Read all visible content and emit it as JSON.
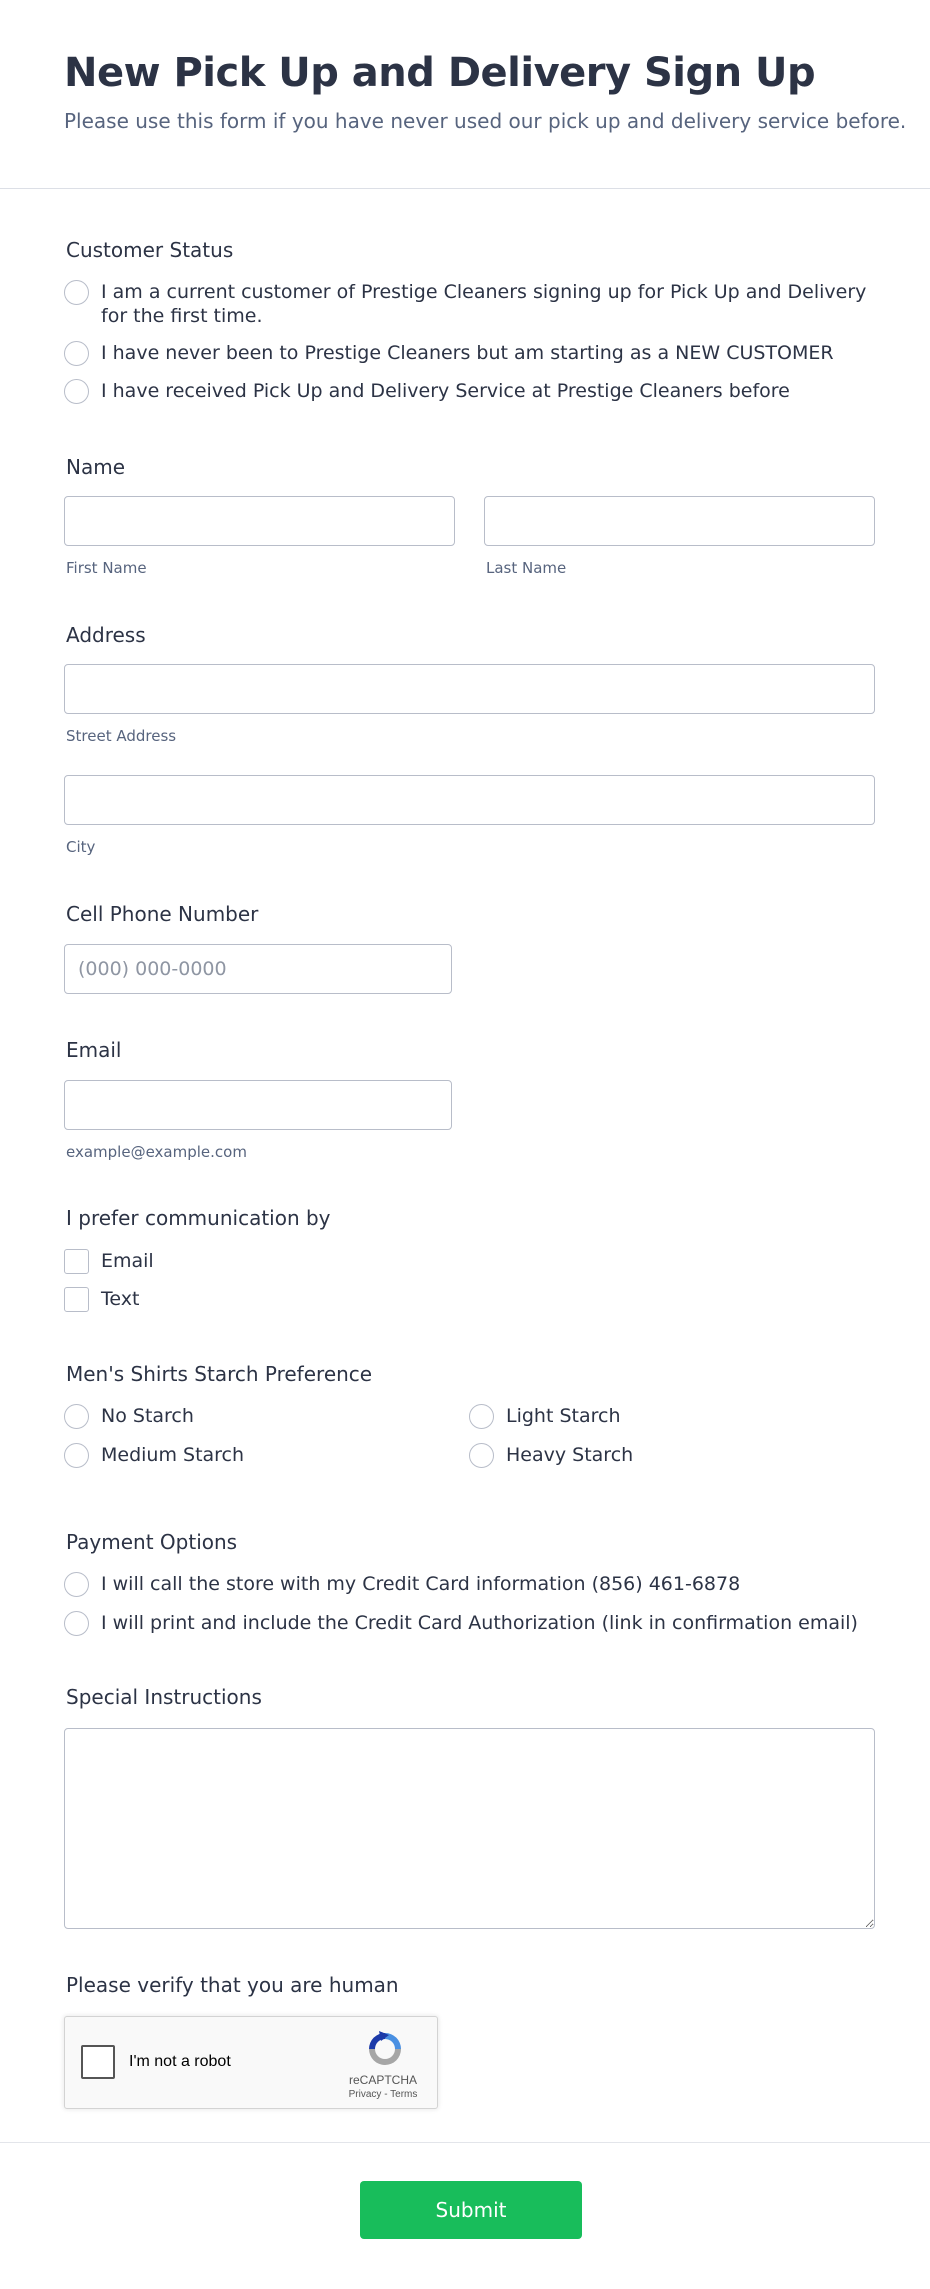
{
  "form": {
    "title": "New Pick Up and Delivery Sign Up",
    "subtitle": "Please use this form if you have never used our pick up and delivery service before."
  },
  "customer_status": {
    "label": "Customer Status",
    "options": [
      "I am a current customer of Prestige Cleaners signing up for Pick Up and Delivery for the first time.",
      "I have never been to Prestige Cleaners but am starting as a NEW CUSTOMER",
      "I have received Pick Up and Delivery Service at Prestige Cleaners before"
    ]
  },
  "name": {
    "label": "Name",
    "first_value": "",
    "last_value": "",
    "first_sublabel": "First Name",
    "last_sublabel": "Last Name"
  },
  "address": {
    "label": "Address",
    "street_value": "",
    "city_value": "",
    "street_sublabel": "Street Address",
    "city_sublabel": "City"
  },
  "phone": {
    "label": "Cell Phone Number",
    "placeholder": "(000) 000-0000",
    "value": ""
  },
  "email": {
    "label": "Email",
    "value": "",
    "sublabel": "example@example.com"
  },
  "communication": {
    "label": "I prefer communication by",
    "options": [
      "Email",
      "Text"
    ]
  },
  "starch": {
    "label": "Men's Shirts Starch Preference",
    "options": [
      "No Starch",
      "Light Starch",
      "Medium Starch",
      "Heavy Starch"
    ]
  },
  "payment": {
    "label": "Payment Options",
    "options": [
      "I will call the store with my Credit Card information (856) 461-6878",
      "I will print and include the Credit Card Authorization (link in confirmation email)"
    ]
  },
  "special_instructions": {
    "label": "Special Instructions",
    "value": ""
  },
  "verify": {
    "label": "Please verify that you are human",
    "checkbox_text": "I'm not a robot",
    "brand": "reCAPTCHA",
    "privacy": "Privacy",
    "separator": " - ",
    "terms": "Terms"
  },
  "submit": {
    "label": "Submit"
  },
  "colors": {
    "submit_bg": "#18bd5b",
    "text": "#2c3345",
    "subtext": "#57647e",
    "border": "#b8bdc9"
  }
}
